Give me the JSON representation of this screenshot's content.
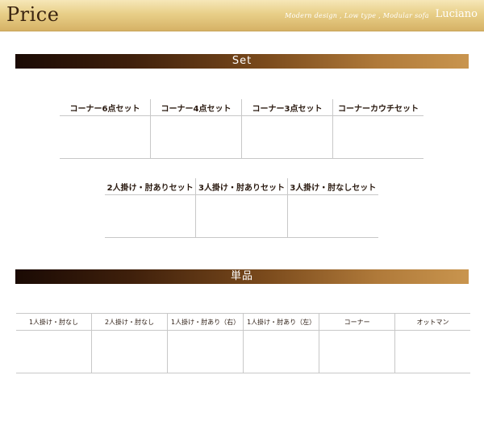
{
  "header": {
    "title": "Price",
    "tagline": "Modern design , Low type , Modular sofa",
    "brand": "Luciano"
  },
  "sections": {
    "set": {
      "label": "Set",
      "row1": [
        "コーナー6点セット",
        "コーナー4点セット",
        "コーナー3点セット",
        "コーナーカウチセット"
      ],
      "row2": [
        "2人掛け・肘ありセット",
        "3人掛け・肘ありセット",
        "3人掛け・肘なしセット"
      ]
    },
    "single": {
      "label": "単品",
      "columns": [
        "1人掛け・肘なし",
        "2人掛け・肘なし",
        "1人掛け・肘あり（右）",
        "1人掛け・肘あり（左）",
        "コーナー",
        "オットマン"
      ]
    }
  },
  "colors": {
    "header_gold": "#e8cf88",
    "bar_dark": "#1a0a04",
    "bar_light": "#c9954e",
    "rule_gray": "#c8c8c8"
  }
}
